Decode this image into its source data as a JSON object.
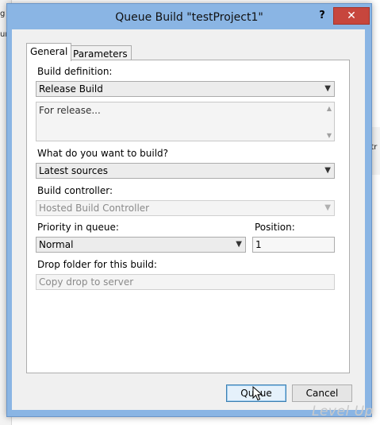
{
  "background": {
    "left_fragments": [
      "g",
      "urc"
    ],
    "right_fragment": "ntr"
  },
  "window": {
    "title": "Queue Build \"testProject1\"",
    "help_glyph": "?",
    "close_glyph": "✕"
  },
  "tabs": [
    {
      "label": "General",
      "active": true
    },
    {
      "label": "Parameters",
      "active": false
    }
  ],
  "form": {
    "build_definition_label": "Build definition:",
    "build_definition_value": "Release Build",
    "description_text": "For release...",
    "what_to_build_label": "What do you want to build?",
    "what_to_build_value": "Latest sources",
    "build_controller_label": "Build controller:",
    "build_controller_value": "Hosted Build Controller",
    "priority_label": "Priority in queue:",
    "priority_value": "Normal",
    "position_label": "Position:",
    "position_value": "1",
    "drop_folder_label": "Drop folder for this build:",
    "drop_folder_value": "Copy drop to server"
  },
  "buttons": {
    "queue_label": "Queue",
    "cancel_label": "Cancel"
  },
  "watermark": "Level Up",
  "colors": {
    "window_frame": "#8ab5e4",
    "close_button": "#c7463d",
    "default_button_border": "#3c7fb1"
  }
}
